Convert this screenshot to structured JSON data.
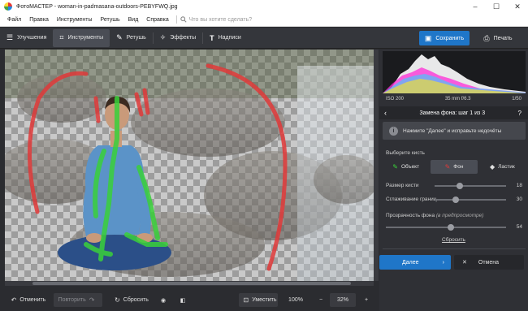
{
  "window": {
    "title": "ФотоМАСТЕР - woman-in-padmasana-outdoors-PEBYFWQ.jpg",
    "minimize": "–",
    "maximize": "☐",
    "close": "✕"
  },
  "menu": {
    "items": [
      "Файл",
      "Правка",
      "Инструменты",
      "Ретушь",
      "Вид",
      "Справка"
    ],
    "search_placeholder": "Что вы хотите сделать?"
  },
  "toolbar": {
    "tabs": [
      {
        "label": "Улучшения",
        "icon": "sliders-icon"
      },
      {
        "label": "Инструменты",
        "icon": "crop-tools-icon"
      },
      {
        "label": "Ретушь",
        "icon": "brush-icon"
      },
      {
        "label": "Эффекты",
        "icon": "magic-wand-icon"
      },
      {
        "label": "Надписи",
        "icon": "text-icon"
      }
    ],
    "save_label": "Сохранить",
    "print_label": "Печать"
  },
  "info": {
    "iso": "ISO 200",
    "lens": "35 mm f/6.3",
    "shutter": "1/50"
  },
  "step": {
    "title": "Замена фона: шаг 1 из 3",
    "help": "?",
    "hint": "Нажмите \"Далее\" и исправьте недочёты"
  },
  "brush": {
    "label": "Выберите кисть",
    "object": "Объект",
    "background": "Фон",
    "eraser": "Ластик"
  },
  "sliders": {
    "size_label": "Размер кисти",
    "size_value": "18",
    "size_fraction": 0.35,
    "smooth_label": "Сглаживание границ",
    "smooth_value": "30",
    "smooth_fraction": 0.3,
    "transparency_label": "Прозрачность фона",
    "transparency_hint": "(в предпросмотре)",
    "transparency_value": "54",
    "transparency_fraction": 0.54
  },
  "reset_link": "Сбросить",
  "buttons": {
    "next": "Далее",
    "cancel": "Отмена"
  },
  "bottom": {
    "undo": "Отменить",
    "redo": "Повторить",
    "reset": "Сбросить",
    "fit": "Уместить",
    "zoom100": "100%",
    "zoom": "32%",
    "minus": "−",
    "plus": "+"
  },
  "colors": {
    "accent": "#1f76c8",
    "object_stroke": "#3ad13a",
    "background_stroke": "#e03a3a"
  }
}
